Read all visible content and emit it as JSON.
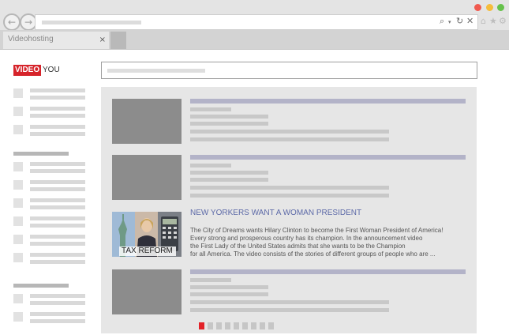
{
  "browser": {
    "tab_label": "Videohosting",
    "tab_close": "×",
    "back_icon": "back-arrow-icon",
    "forward_icon": "forward-arrow-icon",
    "traffic_colors": [
      "#f05a4f",
      "#f5bd3c",
      "#66c24c"
    ]
  },
  "logo": {
    "part1": "VIDEO",
    "part2": "YOU",
    "brand_color": "#d6242b"
  },
  "news": {
    "title": "NEW YORKERS WANT A WOMAN PRESIDENT",
    "thumb_caption": "TAX REFORM",
    "body": [
      "The City of Dreams wants Hilary Clinton to become the First Woman President of America!",
      "Every strong and prosperous country has its champion. In the announcement video",
      "the First Lady of the United States admits that she wants to be the Champion",
      "for all America. The video consists of the stories of different groups of people who are ..."
    ]
  },
  "pagination": {
    "pages": 9,
    "current": 1,
    "active_color": "#e32228"
  }
}
